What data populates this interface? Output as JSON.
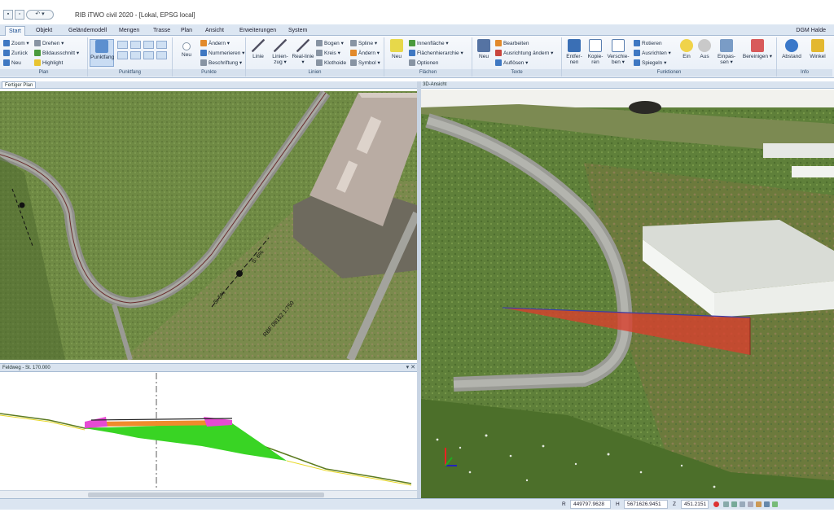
{
  "app": {
    "title": "RIB iTWO civil 2020 - [Lokal, EPSG local]",
    "quick_access": [
      "save",
      "open",
      "undo"
    ],
    "undo_label": "↶ ▾"
  },
  "tabs": [
    {
      "label": "Start",
      "active": true
    },
    {
      "label": "Objekt"
    },
    {
      "label": "Geländemodell"
    },
    {
      "label": "Mengen"
    },
    {
      "label": "Trasse"
    },
    {
      "label": "Plan"
    },
    {
      "label": "Ansicht"
    },
    {
      "label": "Erweiterungen"
    },
    {
      "label": "System"
    }
  ],
  "profile": "DGM Halde",
  "ribbon": {
    "plan": {
      "label": "Plan",
      "zoom": "Zoom ▾",
      "zurueck": "Zurück",
      "neu": "Neu",
      "drehen": "Drehen ▾",
      "bildausschnitt": "Bildausschnitt ▾",
      "highlight": "Highlight"
    },
    "punktfang": {
      "label": "Punktfang",
      "button": "Punktfang"
    },
    "punkte": {
      "label": "Punkte",
      "neu": "Neu",
      "aendern": "Ändern ▾",
      "nummerieren": "Nummerieren ▾",
      "beschriftung": "Beschriftung ▾"
    },
    "linien": {
      "label": "Linien",
      "linie": "Linie",
      "linienzug": "Linien-zug ▾",
      "reallinie": "Real-linie ▾",
      "bogen": "Bogen ▾",
      "kreis": "Kreis ▾",
      "klothoide": "Klothoide",
      "spline": "Spline ▾",
      "aendern": "Ändern ▾",
      "symbol": "Symbol ▾"
    },
    "flaechen": {
      "label": "Flächen",
      "neu": "Neu",
      "innenflaeche": "Innenfläche ▾",
      "flaechenhierarchie": "Flächenhierarchie ▾",
      "optionen": "Optionen"
    },
    "texte": {
      "label": "Texte",
      "neu": "Neu",
      "bearbeiten": "Bearbeiten",
      "ausrichtung": "Ausrichtung ändern ▾",
      "aufloesen": "Auflösen ▾"
    },
    "funktionen": {
      "label": "Funktionen",
      "entfernen": "Entfer-nen",
      "kopieren": "Kopie-ren",
      "verschieben": "Verschie-ben ▾",
      "rotieren": "Rotieren",
      "ausrichten": "Ausrichten ▾",
      "spiegeln": "Spiegeln ▾",
      "ein": "Ein",
      "aus": "Aus",
      "einpassen": "Einpas-sen ▾",
      "bereinigen": "Bereinigen ▾"
    },
    "info": {
      "label": "Info",
      "abstand": "Abstand",
      "winkel": "Winkel"
    }
  },
  "panels": {
    "plan_tab": "Fertiger Plan",
    "view3d_tab": "3D-Ansicht",
    "section_title": "Feldweg - St. 170.000"
  },
  "map2d_labels": {
    "slope1": "S: 5%",
    "slope2": "S: 6%",
    "info": "RBF 09152 1:750"
  },
  "status": {
    "r_label": "R",
    "r_value": "449797.9628",
    "h_label": "H",
    "h_value": "5671626.9451",
    "z_label": "Z",
    "z_value": "451.2151"
  },
  "colors": {
    "ribbon_bg": "#e7eef7",
    "accent": "#1d4f91",
    "section_fill": "#39d424",
    "cut_fill": "#d8402d",
    "road": "#9a9a96"
  }
}
